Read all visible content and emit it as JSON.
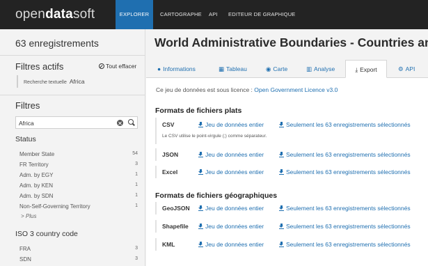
{
  "brand": {
    "light": "open",
    "bold": "data",
    "light2": "soft"
  },
  "nav": [
    "EXPLORER",
    "CARTOGRAPHE",
    "API",
    "EDITEUR DE GRAPHIQUE"
  ],
  "sidebar": {
    "count": "63 enregistrements",
    "active_filters_title": "Filtres actifs",
    "clear_all": "Tout effacer",
    "active_filter": {
      "label": "Recherche textuelle",
      "value": "Africa"
    },
    "filters_title": "Filtres",
    "search_value": "Africa",
    "facets": [
      {
        "title": "Status",
        "items": [
          {
            "label": "Member State",
            "count": "54"
          },
          {
            "label": "FR Territory",
            "count": "3"
          },
          {
            "label": "Adm. by EGY",
            "count": "1"
          },
          {
            "label": "Adm. by KEN",
            "count": "1"
          },
          {
            "label": "Adm. by SDN",
            "count": "1"
          },
          {
            "label": "Non-Self-Governing Territory",
            "count": "1"
          }
        ],
        "more": "> Plus"
      },
      {
        "title": "ISO 3 country code",
        "items": [
          {
            "label": "FRA",
            "count": "3"
          },
          {
            "label": "SDN",
            "count": "3"
          }
        ]
      }
    ]
  },
  "main": {
    "title": "World Administrative Boundaries - Countries and Territories",
    "tabs": [
      {
        "icon": "●",
        "label": "Informations"
      },
      {
        "icon": "▦",
        "label": "Tableau"
      },
      {
        "icon": "◉",
        "label": "Carte"
      },
      {
        "icon": "▥",
        "label": "Analyse"
      },
      {
        "icon": "⤓",
        "label": "Export"
      },
      {
        "icon": "⚙",
        "label": "API"
      }
    ],
    "licence_text": "Ce jeu de données est sous licence : ",
    "licence_link": "Open Government Licence v3.0",
    "flat_title": "Formats de fichiers plats",
    "geo_title": "Formats de fichiers géographiques",
    "full_label": "Jeu de données entier",
    "selected_label": "Seulement les 63 enregistrements sélectionnés",
    "csv_note": "Le CSV utilise le point-virgule (;) comme séparateur.",
    "flat_formats": [
      "CSV",
      "JSON",
      "Excel"
    ],
    "geo_formats": [
      "GeoJSON",
      "Shapefile",
      "KML"
    ]
  },
  "colors": {
    "accent": "#1f6fb0",
    "topbar": "#232323"
  }
}
